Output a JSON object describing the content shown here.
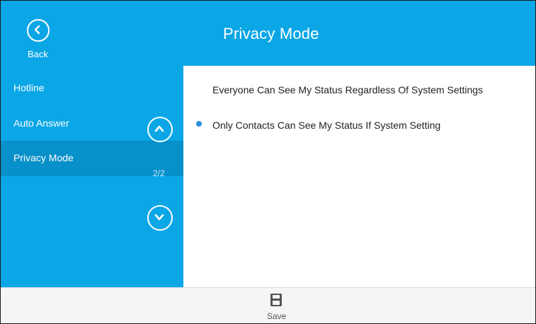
{
  "header": {
    "back_label": "Back",
    "title": "Privacy Mode"
  },
  "sidebar": {
    "items": [
      {
        "label": "Hotline",
        "selected": false
      },
      {
        "label": "Auto Answer",
        "selected": false
      },
      {
        "label": "Privacy Mode",
        "selected": true
      }
    ],
    "page_counter": "2/2",
    "scroll_up_icon": "chevron-up-icon",
    "scroll_down_icon": "chevron-down-icon"
  },
  "options": [
    {
      "label": "Everyone Can See My Status Regardless Of System Settings",
      "selected": false
    },
    {
      "label": "Only Contacts Can See My Status If System Setting",
      "selected": true
    }
  ],
  "footer": {
    "save_label": "Save",
    "save_icon": "floppy-disk-icon"
  },
  "colors": {
    "accent": "#0aa6e6",
    "selected_item": "#0790c9",
    "radio_selected": "#2a8fd8",
    "footer_bg": "#f4f5f7"
  }
}
